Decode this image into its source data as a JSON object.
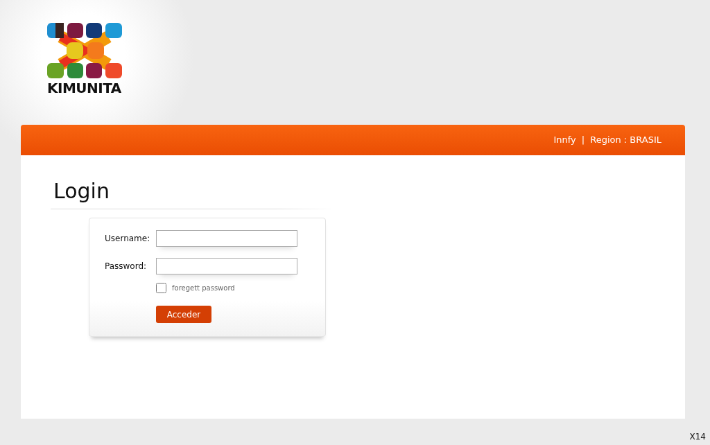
{
  "logo": {
    "wordmark": "KIMUNITA"
  },
  "header": {
    "links": [
      "Innfy",
      "Region : BRASIL"
    ],
    "separator": "|"
  },
  "login": {
    "title": "Login",
    "fields": [
      {
        "label": "Username:"
      },
      {
        "label": "Password:"
      }
    ],
    "remember": {
      "label": "foregett password",
      "checked": false
    },
    "button": "Acceder"
  },
  "footer": "X14"
}
